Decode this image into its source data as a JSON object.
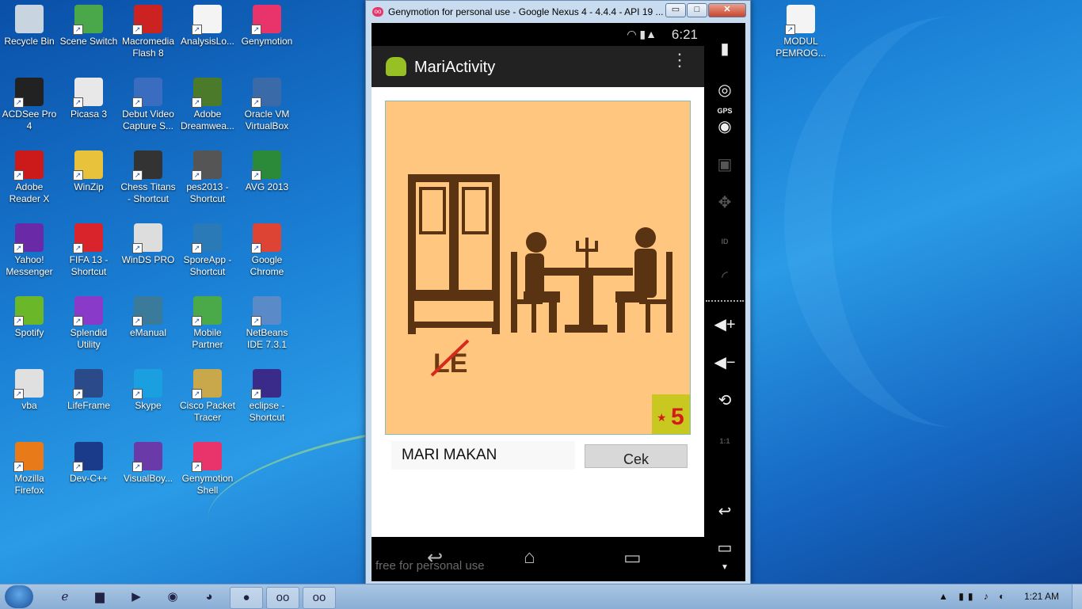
{
  "desktop": {
    "icons": [
      {
        "label": "Recycle Bin",
        "color": "#c8d4e0"
      },
      {
        "label": "Scene Switch",
        "color": "#4aa84a"
      },
      {
        "label": "Macromedia Flash 8",
        "color": "#cc2222"
      },
      {
        "label": "AnalysisLo...",
        "color": "#f4f4f4"
      },
      {
        "label": "Genymotion",
        "color": "#e8336b"
      },
      {
        "label": "ACDSee Pro 4",
        "color": "#222222"
      },
      {
        "label": "Picasa 3",
        "color": "#e8e8e8"
      },
      {
        "label": "Debut Video Capture S...",
        "color": "#3a6cc0"
      },
      {
        "label": "Adobe Dreamwea...",
        "color": "#4a7a2a"
      },
      {
        "label": "Oracle VM VirtualBox",
        "color": "#3a6aa8"
      },
      {
        "label": "Adobe Reader X",
        "color": "#cc1a1a"
      },
      {
        "label": "WinZip",
        "color": "#e8c23a"
      },
      {
        "label": "Chess Titans - Shortcut",
        "color": "#333333"
      },
      {
        "label": "pes2013 - Shortcut",
        "color": "#555555"
      },
      {
        "label": "AVG 2013",
        "color": "#2a8a3a"
      },
      {
        "label": "Yahoo! Messenger",
        "color": "#6a2aa8"
      },
      {
        "label": "FIFA 13 - Shortcut",
        "color": "#d8242a"
      },
      {
        "label": "WinDS PRO",
        "color": "#dddddd"
      },
      {
        "label": "SporeApp - Shortcut",
        "color": "#2a7ab8"
      },
      {
        "label": "Google Chrome",
        "color": "#dd4433"
      },
      {
        "label": "Spotify",
        "color": "#6ab82a"
      },
      {
        "label": "Splendid Utility",
        "color": "#8a3ac8"
      },
      {
        "label": "eManual",
        "color": "#3a7a9a"
      },
      {
        "label": "Mobile Partner",
        "color": "#4aaa4a"
      },
      {
        "label": "NetBeans IDE 7.3.1",
        "color": "#5a8ac8"
      },
      {
        "label": "vba",
        "color": "#e0e0e0"
      },
      {
        "label": "LifeFrame",
        "color": "#2a4a8a"
      },
      {
        "label": "Skype",
        "color": "#1aa0e0"
      },
      {
        "label": "Cisco Packet Tracer",
        "color": "#c8a84a"
      },
      {
        "label": "eclipse - Shortcut",
        "color": "#3a2a8a"
      },
      {
        "label": "Mozilla Firefox",
        "color": "#e87a1a"
      },
      {
        "label": "Dev-C++",
        "color": "#1a3a8a"
      },
      {
        "label": "VisualBoy...",
        "color": "#6a3aa8"
      },
      {
        "label": "Genymotion Shell",
        "color": "#e8336b"
      },
      {
        "label": "MODUL PEMROG...",
        "color": "#f4f4f4"
      }
    ]
  },
  "window": {
    "title": "Genymotion for personal use - Google Nexus 4 - 4.4.4 - API 19 ...",
    "minimize": "▭",
    "restore": "□",
    "close": "✕"
  },
  "device": {
    "clock": "6:21",
    "app_title": "MariActivity",
    "overflow": "⋮",
    "text_field_value": "MARI MAKAN",
    "button_label": "Cek",
    "image_letters": "LE",
    "badge_number": "5",
    "badge_star": "★",
    "watermark": "free for personal use",
    "nav_back": "↩",
    "nav_home": "⌂",
    "nav_recents": "▭"
  },
  "sidepanel": {
    "gps_label": "GPS",
    "id_label": "ID",
    "scale_label": "1:1"
  },
  "taskbar": {
    "time": "1:21 AM",
    "tray_icons": "▲ ▮▮ ♪ ◐"
  }
}
